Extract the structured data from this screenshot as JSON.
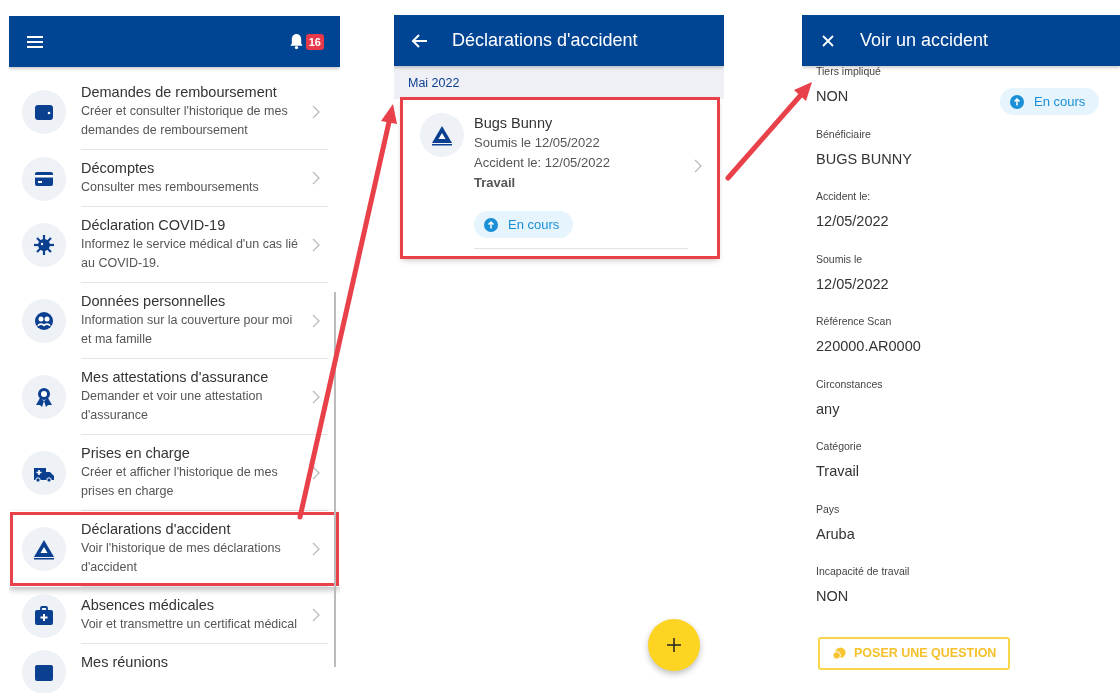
{
  "menu_screen": {
    "notification_count": "16",
    "items": [
      {
        "title": "Demandes de remboursement",
        "subtitle": "Créer et consulter l'historique de mes demandes de remboursement",
        "highlighted": false
      },
      {
        "title": "Décomptes",
        "subtitle": "Consulter mes remboursements",
        "highlighted": false
      },
      {
        "title": "Déclaration COVID-19",
        "subtitle": "Informez le service médical d'un cas lié au COVID-19.",
        "highlighted": false
      },
      {
        "title": "Données personnelles",
        "subtitle": "Information sur la couverture pour moi et ma famille",
        "highlighted": false
      },
      {
        "title": "Mes attestations d'assurance",
        "subtitle": "Demander et voir une attestation d'assurance",
        "highlighted": false
      },
      {
        "title": "Prises en charge",
        "subtitle": "Créer et afficher l'historique de mes prises en charge",
        "highlighted": false
      },
      {
        "title": "Déclarations d'accident",
        "subtitle": "Voir l'historique de mes déclarations d'accident",
        "highlighted": true
      },
      {
        "title": "Absences médicales",
        "subtitle": "Voir et transmettre un certificat médical",
        "highlighted": false
      },
      {
        "title": "Mes réunions",
        "highlighted": false
      }
    ]
  },
  "list_screen": {
    "title": "Déclarations d'accident",
    "section": "Mai 2022",
    "cards": [
      {
        "name": "Bugs Bunny",
        "submitted": "Soumis le 12/05/2022",
        "accident_date": "Accident le: 12/05/2022",
        "category": "Travail",
        "status": "En cours",
        "highlighted": true
      }
    ]
  },
  "detail_screen": {
    "title": "Voir un accident",
    "status": "En cours",
    "fields": [
      {
        "label": "Tiers impliqué",
        "value": "NON"
      },
      {
        "label": "Bénéficiaire",
        "value": "BUGS BUNNY"
      },
      {
        "label": "Accident le:",
        "value": "12/05/2022"
      },
      {
        "label": "Soumis le",
        "value": "12/05/2022"
      },
      {
        "label": "Référence Scan",
        "value": "220000.AR0000"
      },
      {
        "label": "Circonstances",
        "value": "any"
      },
      {
        "label": "Catégorie",
        "value": "Travail"
      },
      {
        "label": "Pays",
        "value": "Aruba"
      },
      {
        "label": "Incapacité de travail",
        "value": "NON"
      }
    ],
    "button": "POSER UNE QUESTION"
  }
}
